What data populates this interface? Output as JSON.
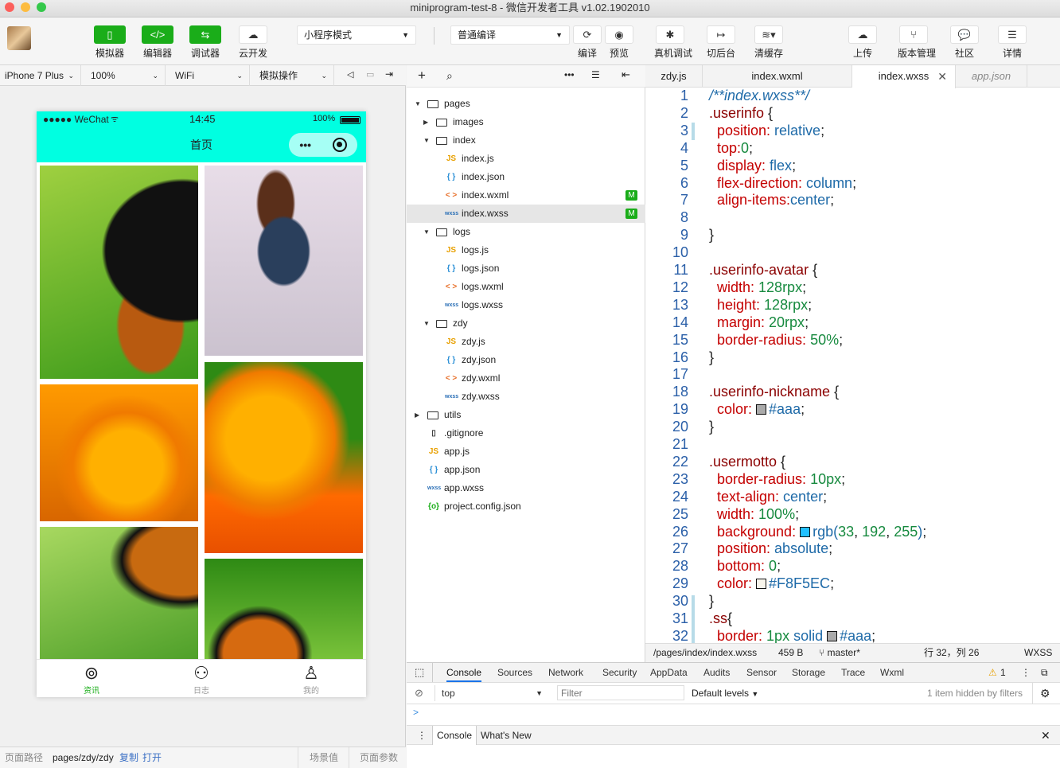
{
  "window": {
    "title": "miniprogram-test-8 - 微信开发者工具 v1.02.1902010"
  },
  "toolbar": {
    "simulator": "模拟器",
    "editor": "编辑器",
    "debugger": "调试器",
    "cloud": "云开发",
    "mode": "小程序模式",
    "compile_mode": "普通编译",
    "compile": "编译",
    "preview": "预览",
    "real_debug": "真机调试",
    "background": "切后台",
    "clear_cache": "清缓存",
    "upload": "上传",
    "version": "版本管理",
    "community": "社区",
    "details": "详情"
  },
  "device": {
    "model": "iPhone 7 Plus",
    "zoom": "100%",
    "network": "WiFi",
    "simulate": "模拟操作"
  },
  "phone": {
    "carrier": "●●●●● WeChat",
    "time": "14:45",
    "battery": "100%",
    "nav_title": "首页",
    "tabs": [
      "资讯",
      "日志",
      "我的"
    ],
    "accent": "#00ffe1",
    "tab_active_color": "#1aad19"
  },
  "sim_footer": {
    "path_label": "页面路径",
    "path": "pages/zdy/zdy",
    "copy": "复制",
    "open": "打开",
    "scene": "场景值",
    "params": "页面参数"
  },
  "tree": [
    {
      "name": "pages",
      "type": "folder",
      "open": true,
      "depth": 0
    },
    {
      "name": "images",
      "type": "folder",
      "open": false,
      "depth": 1
    },
    {
      "name": "index",
      "type": "folder",
      "open": true,
      "depth": 1
    },
    {
      "name": "index.js",
      "type": "js",
      "depth": 2
    },
    {
      "name": "index.json",
      "type": "json",
      "depth": 2
    },
    {
      "name": "index.wxml",
      "type": "wxml",
      "depth": 2,
      "badge": "M"
    },
    {
      "name": "index.wxss",
      "type": "wxss",
      "depth": 2,
      "badge": "M",
      "selected": true
    },
    {
      "name": "logs",
      "type": "folder",
      "open": true,
      "depth": 1
    },
    {
      "name": "logs.js",
      "type": "js",
      "depth": 2
    },
    {
      "name": "logs.json",
      "type": "json",
      "depth": 2
    },
    {
      "name": "logs.wxml",
      "type": "wxml",
      "depth": 2
    },
    {
      "name": "logs.wxss",
      "type": "wxss",
      "depth": 2
    },
    {
      "name": "zdy",
      "type": "folder",
      "open": true,
      "depth": 1
    },
    {
      "name": "zdy.js",
      "type": "js",
      "depth": 2
    },
    {
      "name": "zdy.json",
      "type": "json",
      "depth": 2
    },
    {
      "name": "zdy.wxml",
      "type": "wxml",
      "depth": 2
    },
    {
      "name": "zdy.wxss",
      "type": "wxss",
      "depth": 2
    },
    {
      "name": "utils",
      "type": "folder",
      "open": false,
      "depth": 0
    },
    {
      "name": ".gitignore",
      "type": "file",
      "depth": 0
    },
    {
      "name": "app.js",
      "type": "js",
      "depth": 0
    },
    {
      "name": "app.json",
      "type": "json",
      "depth": 0
    },
    {
      "name": "app.wxss",
      "type": "wxss",
      "depth": 0
    },
    {
      "name": "project.config.json",
      "type": "config",
      "depth": 0
    }
  ],
  "editor_tabs": [
    "zdy.js",
    "index.wxml",
    "index.wxss",
    "app.json"
  ],
  "code": [
    [
      [
        "c",
        "/**index.wxss**/"
      ]
    ],
    [
      [
        "s",
        ".userinfo"
      ],
      [
        "p",
        " {"
      ]
    ],
    [
      [
        "k",
        "  position: "
      ],
      [
        "v",
        "relative"
      ],
      [
        "p",
        ";"
      ]
    ],
    [
      [
        "k",
        "  top:"
      ],
      [
        "n",
        "0"
      ],
      [
        "p",
        ";"
      ]
    ],
    [
      [
        "k",
        "  display: "
      ],
      [
        "v",
        "flex"
      ],
      [
        "p",
        ";"
      ]
    ],
    [
      [
        "k",
        "  flex-direction: "
      ],
      [
        "v",
        "column"
      ],
      [
        "p",
        ";"
      ]
    ],
    [
      [
        "k",
        "  align-items:"
      ],
      [
        "v",
        "center"
      ],
      [
        "p",
        ";"
      ]
    ],
    [],
    [
      [
        "p",
        "}"
      ]
    ],
    [],
    [
      [
        "s",
        ".userinfo-avatar"
      ],
      [
        "p",
        " {"
      ]
    ],
    [
      [
        "k",
        "  width: "
      ],
      [
        "n",
        "128rpx"
      ],
      [
        "p",
        ";"
      ]
    ],
    [
      [
        "k",
        "  height: "
      ],
      [
        "n",
        "128rpx"
      ],
      [
        "p",
        ";"
      ]
    ],
    [
      [
        "k",
        "  margin: "
      ],
      [
        "n",
        "20rpx"
      ],
      [
        "p",
        ";"
      ]
    ],
    [
      [
        "k",
        "  border-radius: "
      ],
      [
        "n",
        "50%"
      ],
      [
        "p",
        ";"
      ]
    ],
    [
      [
        "p",
        "}"
      ]
    ],
    [],
    [
      [
        "s",
        ".userinfo-nickname"
      ],
      [
        "p",
        " {"
      ]
    ],
    [
      [
        "k",
        "  color: "
      ],
      [
        "sw",
        "#aaaaaa"
      ],
      [
        "v",
        "#aaa"
      ],
      [
        "p",
        ";"
      ]
    ],
    [
      [
        "p",
        "}"
      ]
    ],
    [],
    [
      [
        "s",
        ".usermotto"
      ],
      [
        "p",
        " {"
      ]
    ],
    [
      [
        "k",
        "  border-radius: "
      ],
      [
        "n",
        "10px"
      ],
      [
        "p",
        ";"
      ]
    ],
    [
      [
        "k",
        "  text-align: "
      ],
      [
        "v",
        "center"
      ],
      [
        "p",
        ";"
      ]
    ],
    [
      [
        "k",
        "  width: "
      ],
      [
        "n",
        "100%"
      ],
      [
        "p",
        ";"
      ]
    ],
    [
      [
        "k",
        "  background: "
      ],
      [
        "sw",
        "#21c0ff"
      ],
      [
        "v",
        "rgb("
      ],
      [
        "n",
        "33"
      ],
      [
        "p",
        ", "
      ],
      [
        "n",
        "192"
      ],
      [
        "p",
        ", "
      ],
      [
        "n",
        "255"
      ],
      [
        "v",
        ")"
      ],
      [
        "p",
        ";"
      ]
    ],
    [
      [
        "k",
        "  position: "
      ],
      [
        "v",
        "absolute"
      ],
      [
        "p",
        ";"
      ]
    ],
    [
      [
        "k",
        "  bottom: "
      ],
      [
        "n",
        "0"
      ],
      [
        "p",
        ";"
      ]
    ],
    [
      [
        "k",
        "  color: "
      ],
      [
        "sw",
        "#F8F5EC"
      ],
      [
        "v",
        "#F8F5EC"
      ],
      [
        "p",
        ";"
      ]
    ],
    [
      [
        "p",
        "}"
      ]
    ],
    [
      [
        "s",
        ".ss"
      ],
      [
        "p",
        "{"
      ]
    ],
    [
      [
        "k",
        "  border: "
      ],
      [
        "n",
        "1px"
      ],
      [
        "v",
        " solid "
      ],
      [
        "sw",
        "#aaaaaa"
      ],
      [
        "v",
        "#aaa"
      ],
      [
        "p",
        ";"
      ]
    ]
  ],
  "status": {
    "path": "/pages/index/index.wxss",
    "size": "459 B",
    "branch": "master*",
    "cursor": "行 32，列 26",
    "lang": "WXSS"
  },
  "console": {
    "tabs": [
      "Console",
      "Sources",
      "Network",
      "Security",
      "AppData",
      "Audits",
      "Sensor",
      "Storage",
      "Trace",
      "Wxml"
    ],
    "warn_count": "1",
    "context": "top",
    "filter_placeholder": "Filter",
    "levels": "Default levels",
    "hidden": "1 item hidden by filters",
    "prompt": ">",
    "drawer_tabs": [
      "Console",
      "What's New"
    ]
  }
}
